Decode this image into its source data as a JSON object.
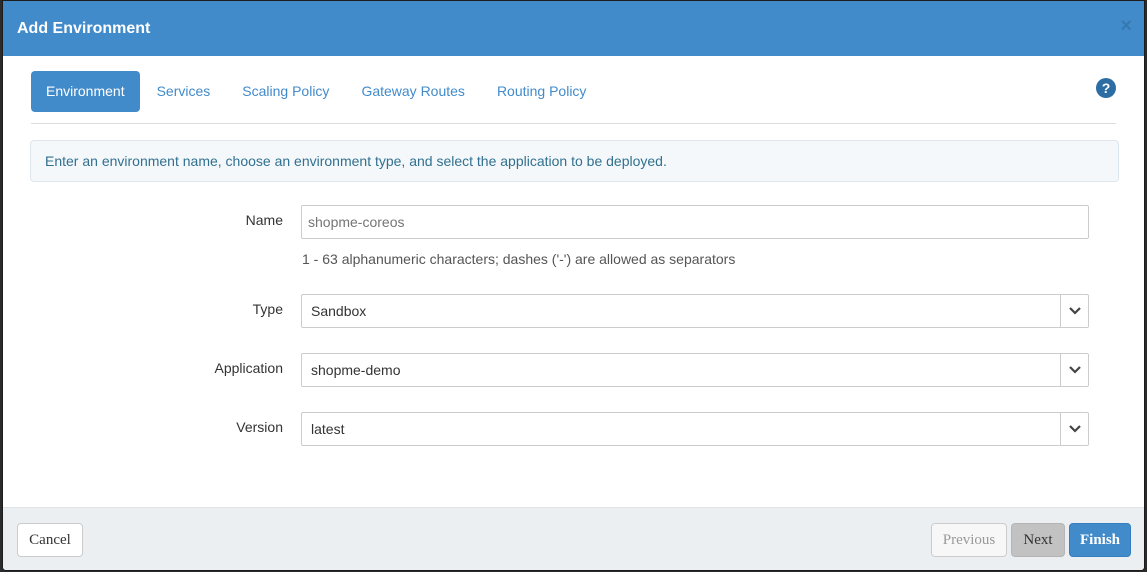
{
  "modal": {
    "title": "Add Environment",
    "close_glyph": "×"
  },
  "tabs": [
    {
      "label": "Environment",
      "active": true
    },
    {
      "label": "Services",
      "active": false
    },
    {
      "label": "Scaling Policy",
      "active": false
    },
    {
      "label": "Gateway Routes",
      "active": false
    },
    {
      "label": "Routing Policy",
      "active": false
    }
  ],
  "help_glyph": "?",
  "info": "Enter an environment name, choose an environment type, and select the application to be deployed.",
  "form": {
    "name": {
      "label": "Name",
      "placeholder": "shopme-coreos",
      "help": "1 - 63 alphanumeric characters; dashes ('-') are allowed as separators"
    },
    "type": {
      "label": "Type",
      "value": "Sandbox"
    },
    "application": {
      "label": "Application",
      "value": "shopme-demo"
    },
    "version": {
      "label": "Version",
      "value": "latest"
    }
  },
  "footer": {
    "cancel": "Cancel",
    "previous": "Previous",
    "next": "Next",
    "finish": "Finish"
  },
  "colors": {
    "primary": "#428bca",
    "info_text": "#31708f"
  }
}
